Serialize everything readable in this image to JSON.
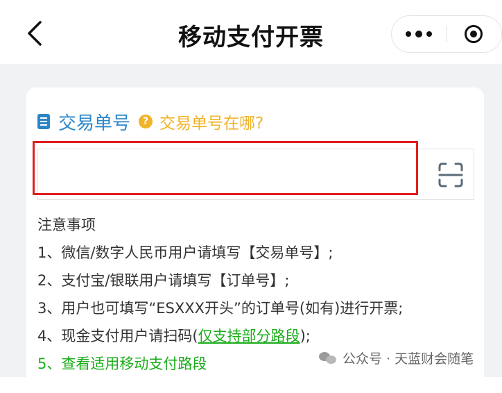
{
  "header": {
    "title": "移动支付开票"
  },
  "field": {
    "label": "交易单号",
    "help": "交易单号在哪?",
    "value": "",
    "placeholder": ""
  },
  "notes": {
    "heading": "注意事项",
    "items": [
      "1、微信/数字人民币用户请填写【交易单号】;",
      "2、支付宝/银联用户请填写【订单号】;",
      "3、用户也可填写“ESXXX开头”的订单号(如有)进行开票;"
    ],
    "item4_prefix": "4、现金支付用户请扫码(",
    "item4_link": "仅支持部分路段",
    "item4_suffix": ");",
    "item5": "5、查看适用移动支付路段"
  },
  "watermark": {
    "text": "公众号 · 天蓝财会随笔"
  },
  "colors": {
    "accent_blue": "#2a86c8",
    "help_yellow": "#f0b429",
    "link_green": "#1aad19",
    "highlight_red": "#e0201f"
  }
}
